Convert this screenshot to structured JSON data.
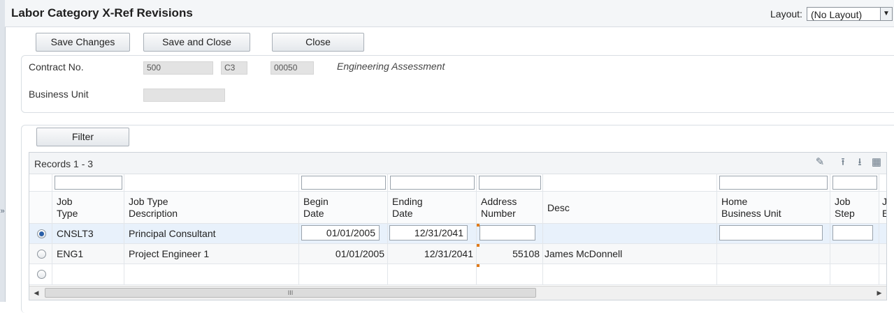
{
  "window": {
    "title": "Labor Category X-Ref Revisions",
    "layout_label": "Layout:",
    "layout_value": "(No Layout)"
  },
  "toolbar": {
    "save_changes": "Save Changes",
    "save_and_close": "Save and Close",
    "close": "Close"
  },
  "header_form": {
    "contract_label": "Contract No.",
    "contract_number": "500",
    "contract_type": "C3",
    "contract_company": "00050",
    "contract_description": "Engineering Assessment",
    "business_unit_label": "Business Unit",
    "business_unit_value": ""
  },
  "filter_button": "Filter",
  "grid": {
    "records_label": "Records 1 - 3",
    "columns": [
      {
        "line1": "Job",
        "line2": "Type"
      },
      {
        "line1": "Job Type",
        "line2": "Description"
      },
      {
        "line1": "Begin",
        "line2": "Date"
      },
      {
        "line1": "Ending",
        "line2": "Date"
      },
      {
        "line1": "Address",
        "line2": "Number"
      },
      {
        "line1": "Desc",
        "line2": ""
      },
      {
        "line1": "Home",
        "line2": "Business Unit"
      },
      {
        "line1": "Job",
        "line2": "Step"
      },
      {
        "line1": "J",
        "line2": "E"
      }
    ],
    "rows": [
      {
        "selected": true,
        "job_type": "CNSLT3",
        "description": "Principal Consultant",
        "begin_date": "01/01/2005",
        "ending_date": "12/31/2041",
        "address_number": "",
        "desc": "",
        "home_bu": "",
        "job_step": ""
      },
      {
        "selected": false,
        "job_type": "ENG1",
        "description": "Project Engineer 1",
        "begin_date": "01/01/2005",
        "ending_date": "12/31/2041",
        "address_number": "55108",
        "desc": "James McDonnell",
        "home_bu": "",
        "job_step": ""
      },
      {
        "selected": false,
        "job_type": "",
        "description": "",
        "begin_date": "",
        "ending_date": "",
        "address_number": "",
        "desc": "",
        "home_bu": "",
        "job_step": ""
      }
    ]
  },
  "icons": {
    "sidebar_toggle": "double-chevron-right-icon",
    "edit": "pencil-icon",
    "export": "upload-icon",
    "import": "download-icon",
    "grid_settings": "grid-icon"
  },
  "colors": {
    "selected_row": "#e8f1fb",
    "required_marker": "#e07b1c",
    "radio_selected": "#2a5fa8"
  }
}
